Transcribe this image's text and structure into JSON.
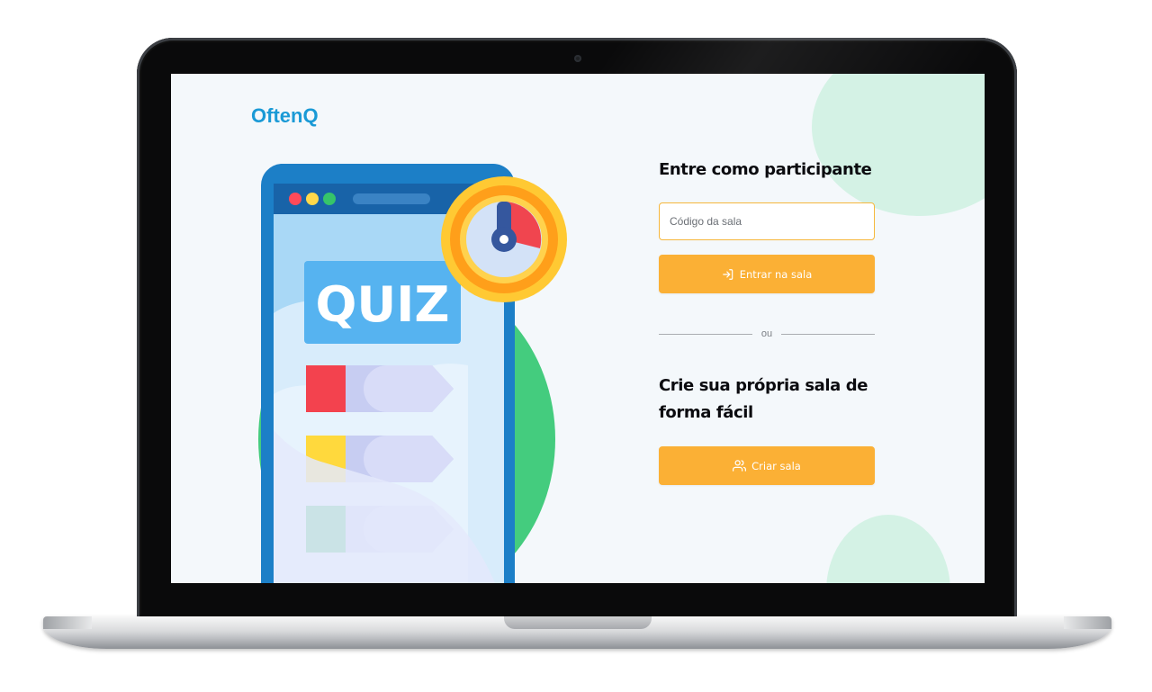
{
  "app": {
    "logo": "OftenQ"
  },
  "illustration": {
    "sign_text": "QUIZ"
  },
  "join": {
    "title": "Entre como participante",
    "code_placeholder": "Código da sala",
    "code_value": "",
    "enter_button_label": "Entrar na sala",
    "enter_icon": "log-in-icon"
  },
  "divider": {
    "label": "ou"
  },
  "create": {
    "title": "Crie sua própria sala de forma fácil",
    "button_label": "Criar sala",
    "button_icon": "users-icon"
  },
  "colors": {
    "brand": "#1a9ad6",
    "accent": "#fbb035",
    "input_border": "#f6b73c",
    "background": "#f4f8fb",
    "blob": "#d4f2e5"
  }
}
